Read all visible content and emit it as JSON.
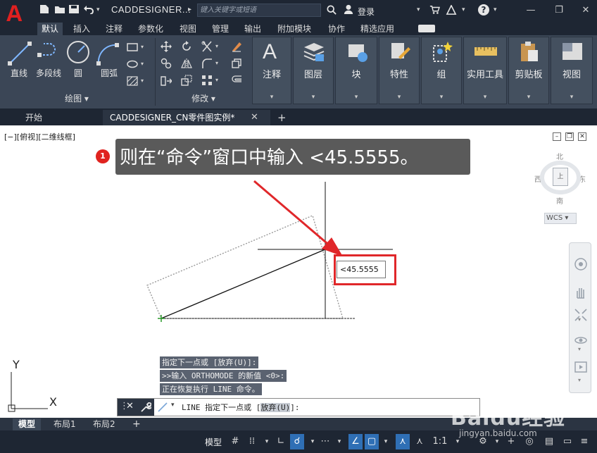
{
  "titlebar": {
    "app_logo": "A",
    "title": "CADDESIGNER...",
    "search_placeholder": "键入关键字或短语",
    "login": "登录",
    "help": "?"
  },
  "ribbon_tabs": [
    "默认",
    "插入",
    "注释",
    "参数化",
    "视图",
    "管理",
    "输出",
    "附加模块",
    "协作",
    "精选应用"
  ],
  "ribbon": {
    "draw": {
      "items": [
        "直线",
        "多段线",
        "圆",
        "圆弧"
      ],
      "footer": "绘图"
    },
    "modify": {
      "footer": "修改"
    },
    "big_buttons": [
      "注释",
      "图层",
      "块",
      "特性",
      "组",
      "实用工具",
      "剪贴板",
      "视图"
    ]
  },
  "doc_tabs": {
    "start": "开始",
    "current": "CADDESIGNER_CN零件图实例*",
    "plus": "+"
  },
  "viewport": {
    "label": "[−][俯视][二维线框]",
    "compass": {
      "north": "北",
      "south": "南",
      "east": "东",
      "west": "西",
      "center": "上"
    },
    "wcs": "WCS ▾"
  },
  "callout": {
    "number": "1",
    "text": "则在“命令”窗口中输入 <45.5555。"
  },
  "dynamic_input": {
    "value": "<45.5555"
  },
  "command_history": [
    "指定下一点或 [放弃(U)]:",
    ">>输入 ORTHOMODE 的新值 <0>:",
    "正在恢复执行 LINE 命令。"
  ],
  "command_line": {
    "prefix": "LINE 指定下一点或 [",
    "option": "放弃(U)",
    "suffix": "]:"
  },
  "ucs": {
    "y": "Y",
    "x": "X"
  },
  "layout_tabs": [
    "模型",
    "布局1",
    "布局2"
  ],
  "status": {
    "model": "模型",
    "scale": "1:1"
  },
  "watermark": {
    "main": "Baidu经验",
    "sub": "jingyan.baidu.com"
  },
  "colors": {
    "titlebar": "#1e2633",
    "ribbon": "#3b4656",
    "accent_red": "#e0272a",
    "status_on": "#2f6fb5"
  }
}
